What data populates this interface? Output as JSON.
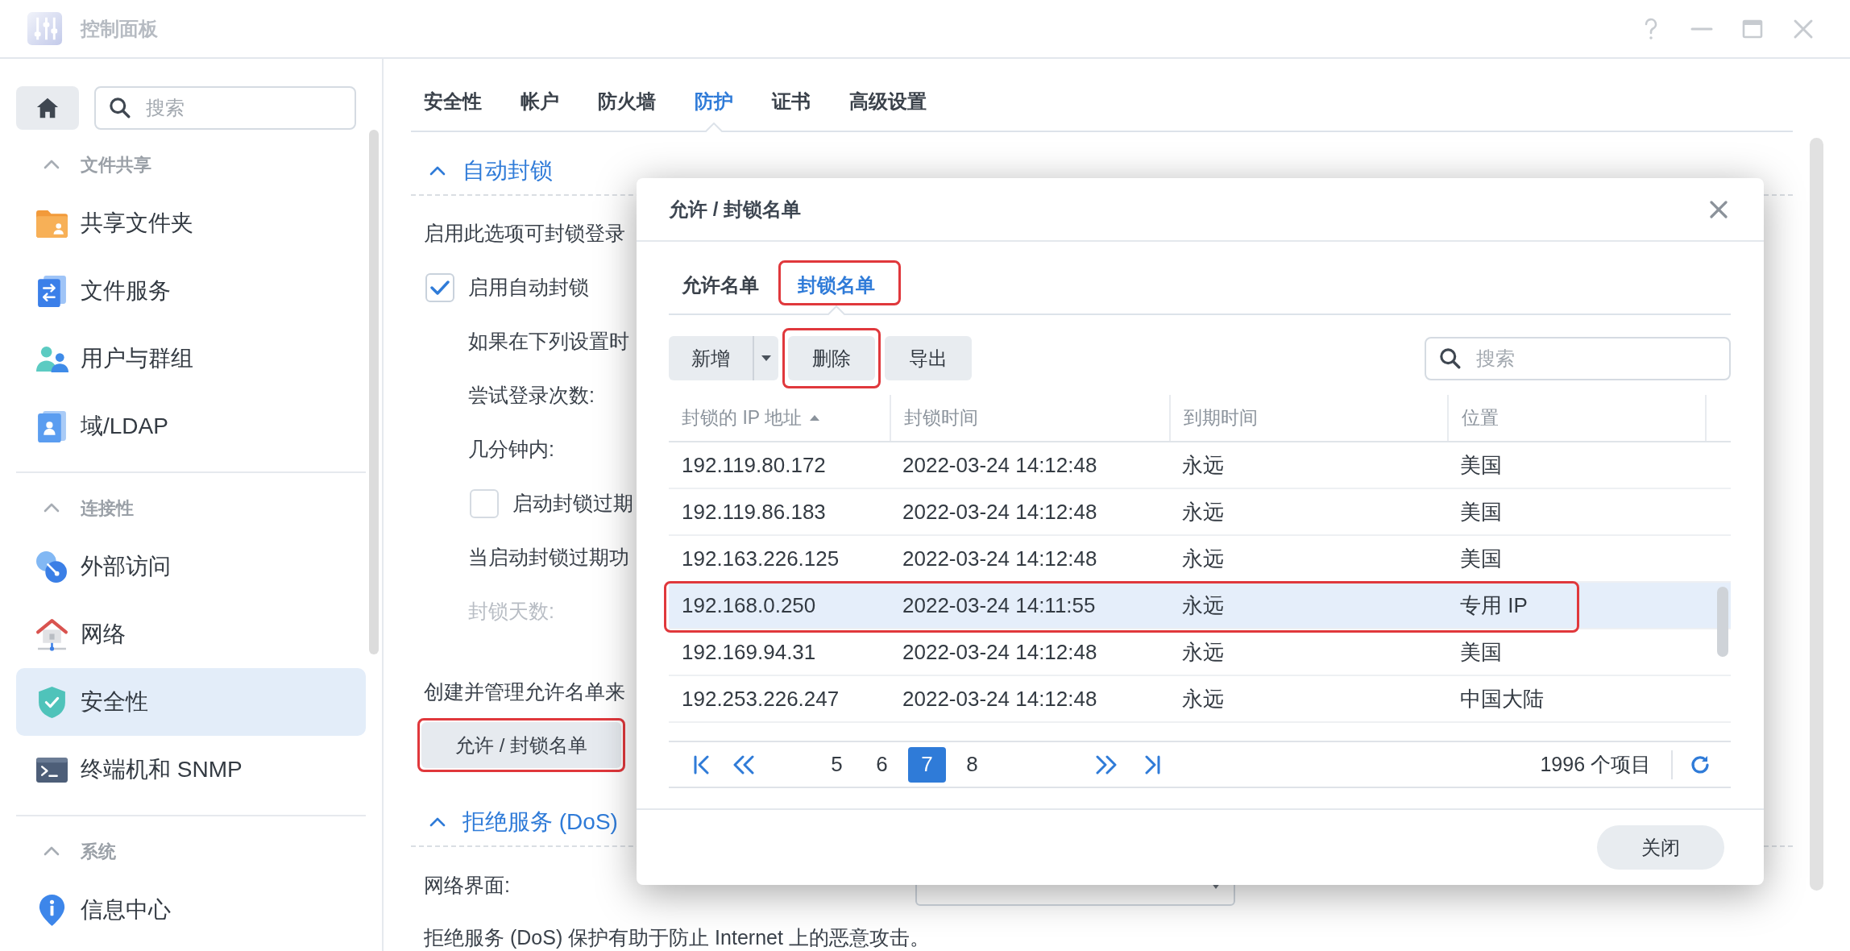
{
  "window": {
    "title": "控制面板"
  },
  "sidebar": {
    "search": {
      "placeholder": "搜索"
    },
    "sections": [
      {
        "title": "文件共享",
        "expanded": true,
        "items": [
          {
            "label": "共享文件夹",
            "selected": false
          },
          {
            "label": "文件服务",
            "selected": false
          },
          {
            "label": "用户与群组",
            "selected": false
          },
          {
            "label": "域/LDAP",
            "selected": false
          }
        ]
      },
      {
        "title": "连接性",
        "expanded": true,
        "items": [
          {
            "label": "外部访问",
            "selected": false
          },
          {
            "label": "网络",
            "selected": false
          },
          {
            "label": "安全性",
            "selected": true
          },
          {
            "label": "终端机和 SNMP",
            "selected": false
          }
        ]
      },
      {
        "title": "系统",
        "expanded": true,
        "items": [
          {
            "label": "信息中心",
            "selected": false
          }
        ]
      }
    ]
  },
  "tabs": [
    {
      "label": "安全性",
      "selected": false
    },
    {
      "label": "帐户",
      "selected": false
    },
    {
      "label": "防火墙",
      "selected": false
    },
    {
      "label": "防护",
      "selected": true
    },
    {
      "label": "证书",
      "selected": false
    },
    {
      "label": "高级设置",
      "selected": false
    }
  ],
  "sections": [
    {
      "title": "自动封锁",
      "expanded": true,
      "paragraphs": [
        [
          {
            "kind": "text",
            "text": "启用此选项可封锁登录",
            "disabled": false
          },
          {
            "kind": "checkbox",
            "label": "启用自动封锁",
            "checked": true,
            "disabled": false,
            "children": [
              {
                "kind": "text",
                "text": "如果在下列设置时",
                "disabled": false
              },
              {
                "kind": "text",
                "text": "尝试登录次数:",
                "disabled": false
              },
              {
                "kind": "text",
                "text": "几分钟内:",
                "disabled": false
              },
              {
                "kind": "checkbox",
                "label": "启动封锁过期",
                "checked": false,
                "disabled": false
              },
              {
                "kind": "text",
                "text": "当启动封锁过期功",
                "disabled": false
              },
              {
                "kind": "text",
                "text": "封锁天数:",
                "disabled": true
              }
            ]
          }
        ],
        [
          {
            "kind": "text",
            "text": "创建并管理允许名单来",
            "disabled": false
          },
          {
            "kind": "button",
            "label": "允许 / 封锁名单",
            "highlighted": true,
            "disabled": false
          }
        ]
      ]
    },
    {
      "title": "拒绝服务 (DoS)",
      "expanded": true,
      "paragraphs": [
        [
          {
            "kind": "select",
            "label": "网络界面:",
            "disabled": false
          },
          {
            "kind": "text",
            "text": "拒绝服务 (DoS) 保护有助于防止 Internet 上的恶意攻击。",
            "disabled": false
          }
        ]
      ]
    }
  ],
  "dialog": {
    "title": "允许 / 封锁名单",
    "tabs": [
      {
        "label": "允许名单",
        "selected": false,
        "highlighted": false
      },
      {
        "label": "封锁名单",
        "selected": true,
        "highlighted": true
      }
    ],
    "toolbar": [
      {
        "kind": "split",
        "label": "新增",
        "highlighted": false
      },
      {
        "kind": "button",
        "label": "删除",
        "highlighted": true
      },
      {
        "kind": "button",
        "label": "导出",
        "highlighted": false
      }
    ],
    "search": {
      "placeholder": "搜索"
    },
    "table": {
      "columns": [
        {
          "label": "封锁的 IP 地址",
          "sorted": true
        },
        {
          "label": "封锁时间",
          "sorted": false
        },
        {
          "label": "到期时间",
          "sorted": false
        },
        {
          "label": "位置",
          "sorted": false
        }
      ],
      "rows": [
        {
          "cells": [
            "192.119.80.172",
            "2022-03-24 14:12:48",
            "永远",
            "美国"
          ],
          "selected": false,
          "highlighted": false
        },
        {
          "cells": [
            "192.119.86.183",
            "2022-03-24 14:12:48",
            "永远",
            "美国"
          ],
          "selected": false,
          "highlighted": false
        },
        {
          "cells": [
            "192.163.226.125",
            "2022-03-24 14:12:48",
            "永远",
            "美国"
          ],
          "selected": false,
          "highlighted": false
        },
        {
          "cells": [
            "192.168.0.250",
            "2022-03-24 14:11:55",
            "永远",
            "专用 IP"
          ],
          "selected": true,
          "highlighted": true
        },
        {
          "cells": [
            "192.169.94.31",
            "2022-03-24 14:12:48",
            "永远",
            "美国"
          ],
          "selected": false,
          "highlighted": false
        },
        {
          "cells": [
            "192.253.226.247",
            "2022-03-24 14:12:48",
            "永远",
            "中国大陆"
          ],
          "selected": false,
          "highlighted": false
        }
      ]
    },
    "pager": {
      "pages": [
        {
          "label": "5",
          "selected": false
        },
        {
          "label": "6",
          "selected": false
        },
        {
          "label": "7",
          "selected": true
        },
        {
          "label": "8",
          "selected": false
        }
      ],
      "count": "1996 个项目"
    },
    "close_button": {
      "label": "关闭"
    }
  }
}
